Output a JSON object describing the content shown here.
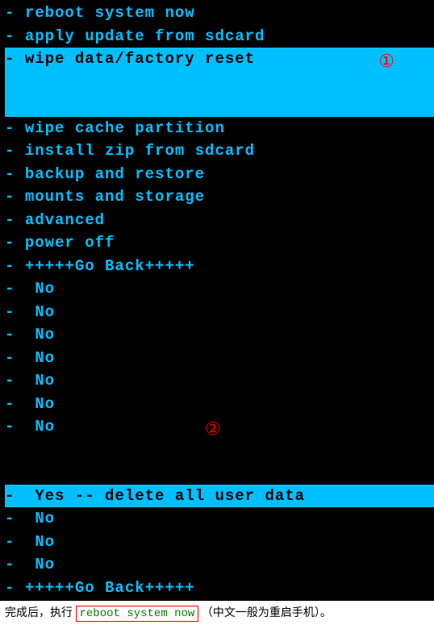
{
  "menu": {
    "items": [
      {
        "label": "reboot system now",
        "selected": false
      },
      {
        "label": "apply update from sdcard",
        "selected": false
      },
      {
        "label": "wipe data/factory reset",
        "selected": true
      },
      {
        "label": "wipe cache partition",
        "selected": false
      },
      {
        "label": "install zip from sdcard",
        "selected": false
      },
      {
        "label": "backup and restore",
        "selected": false
      },
      {
        "label": "mounts and storage",
        "selected": false
      },
      {
        "label": "advanced",
        "selected": false
      },
      {
        "label": "power off",
        "selected": false
      },
      {
        "label": "+++++Go Back+++++",
        "selected": false
      }
    ]
  },
  "submenu": {
    "items": [
      {
        "label": "No",
        "selected": false
      },
      {
        "label": "No",
        "selected": false
      },
      {
        "label": "No",
        "selected": false
      },
      {
        "label": "No",
        "selected": false
      },
      {
        "label": "No",
        "selected": false
      },
      {
        "label": "No",
        "selected": false
      },
      {
        "label": "No",
        "selected": false
      },
      {
        "label": "Yes -- delete all user data",
        "selected": true
      },
      {
        "label": "No",
        "selected": false
      },
      {
        "label": "No",
        "selected": false
      },
      {
        "label": "No",
        "selected": false
      },
      {
        "label": "+++++Go Back+++++",
        "selected": false
      }
    ]
  },
  "annotations": {
    "num1": "①",
    "num2": "②"
  },
  "caption": {
    "pre_text": "完成后，执行",
    "cmd": "reboot system now",
    "post_text": "（中文一般为重启手机）。"
  }
}
